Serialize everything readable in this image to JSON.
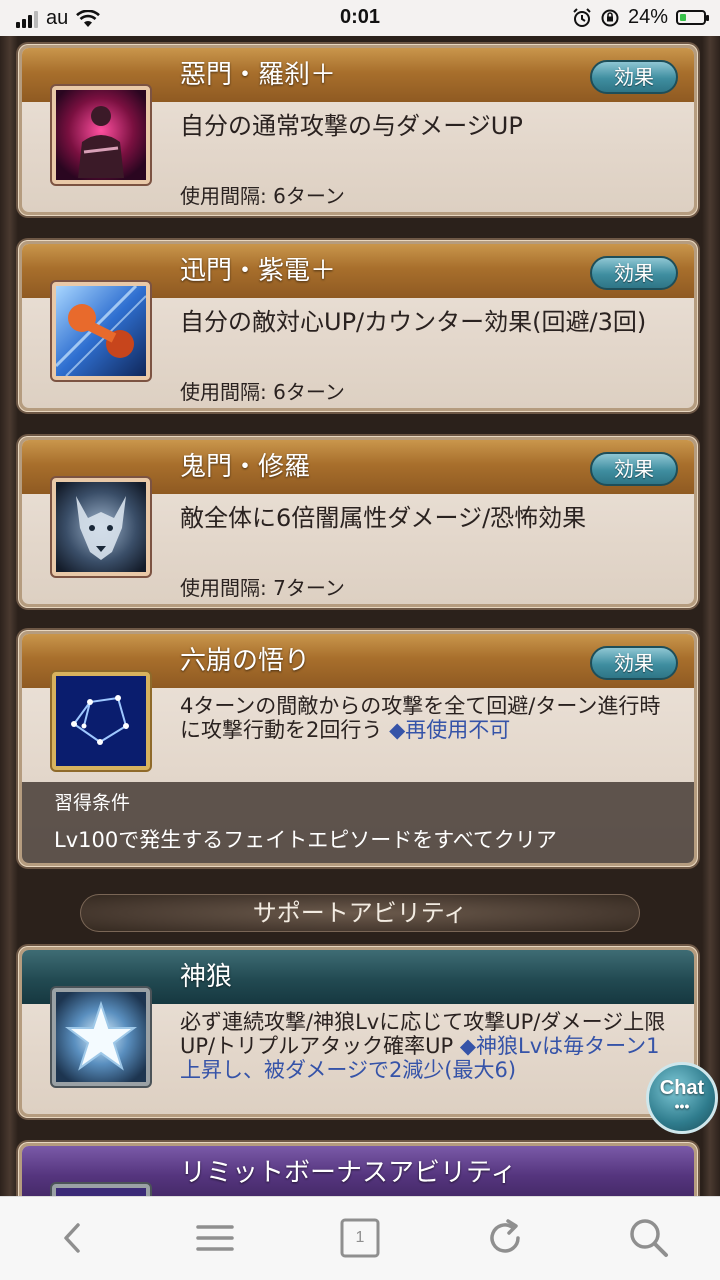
{
  "status_bar": {
    "carrier": "au",
    "time": "0:01",
    "battery_percent": "24%",
    "battery_level": 0.24
  },
  "abilities": [
    {
      "title": "惡門・羅刹＋",
      "effect_button": "効果",
      "description": "自分の通常攻撃の与ダメージUP",
      "cooldown": "使用間隔: 6ターン",
      "icon": "red-aura-warrior-icon"
    },
    {
      "title": "迅門・紫電＋",
      "effect_button": "効果",
      "description": "自分の敵対心UP/カウンター効果(回避/3回)",
      "cooldown": "使用間隔: 6ターン",
      "icon": "fist-icon"
    },
    {
      "title": "鬼門・修羅",
      "effect_button": "効果",
      "description": "敵全体に6倍闇属性ダメージ/恐怖効果",
      "cooldown": "使用間隔: 7ターン",
      "icon": "wolf-icon"
    },
    {
      "title": "六崩の悟り",
      "effect_button": "効果",
      "description": "4ターンの間敵からの攻撃を全て回避/ターン進行時に攻撃行動を2回行う",
      "note": "◆再使用不可",
      "condition_label": "習得条件",
      "condition_text": "Lv100で発生するフェイトエピソードをすべてクリア",
      "icon": "constellation-icon"
    }
  ],
  "support_section": {
    "header": "サポートアビリティ",
    "title": "神狼",
    "description": "必ず連続攻撃/神狼Lvに応じて攻撃UP/ダメージ上限UP/トリプルアタック確率UP",
    "note": "◆神狼Lvは毎ターン1上昇し、被ダメージで2減少(最大6)",
    "icon": "star-icon"
  },
  "limit_section": {
    "title": "リミットボーナスアビリティ"
  },
  "chat_button": "Chat",
  "toolbar": {
    "tab_count": "1"
  }
}
